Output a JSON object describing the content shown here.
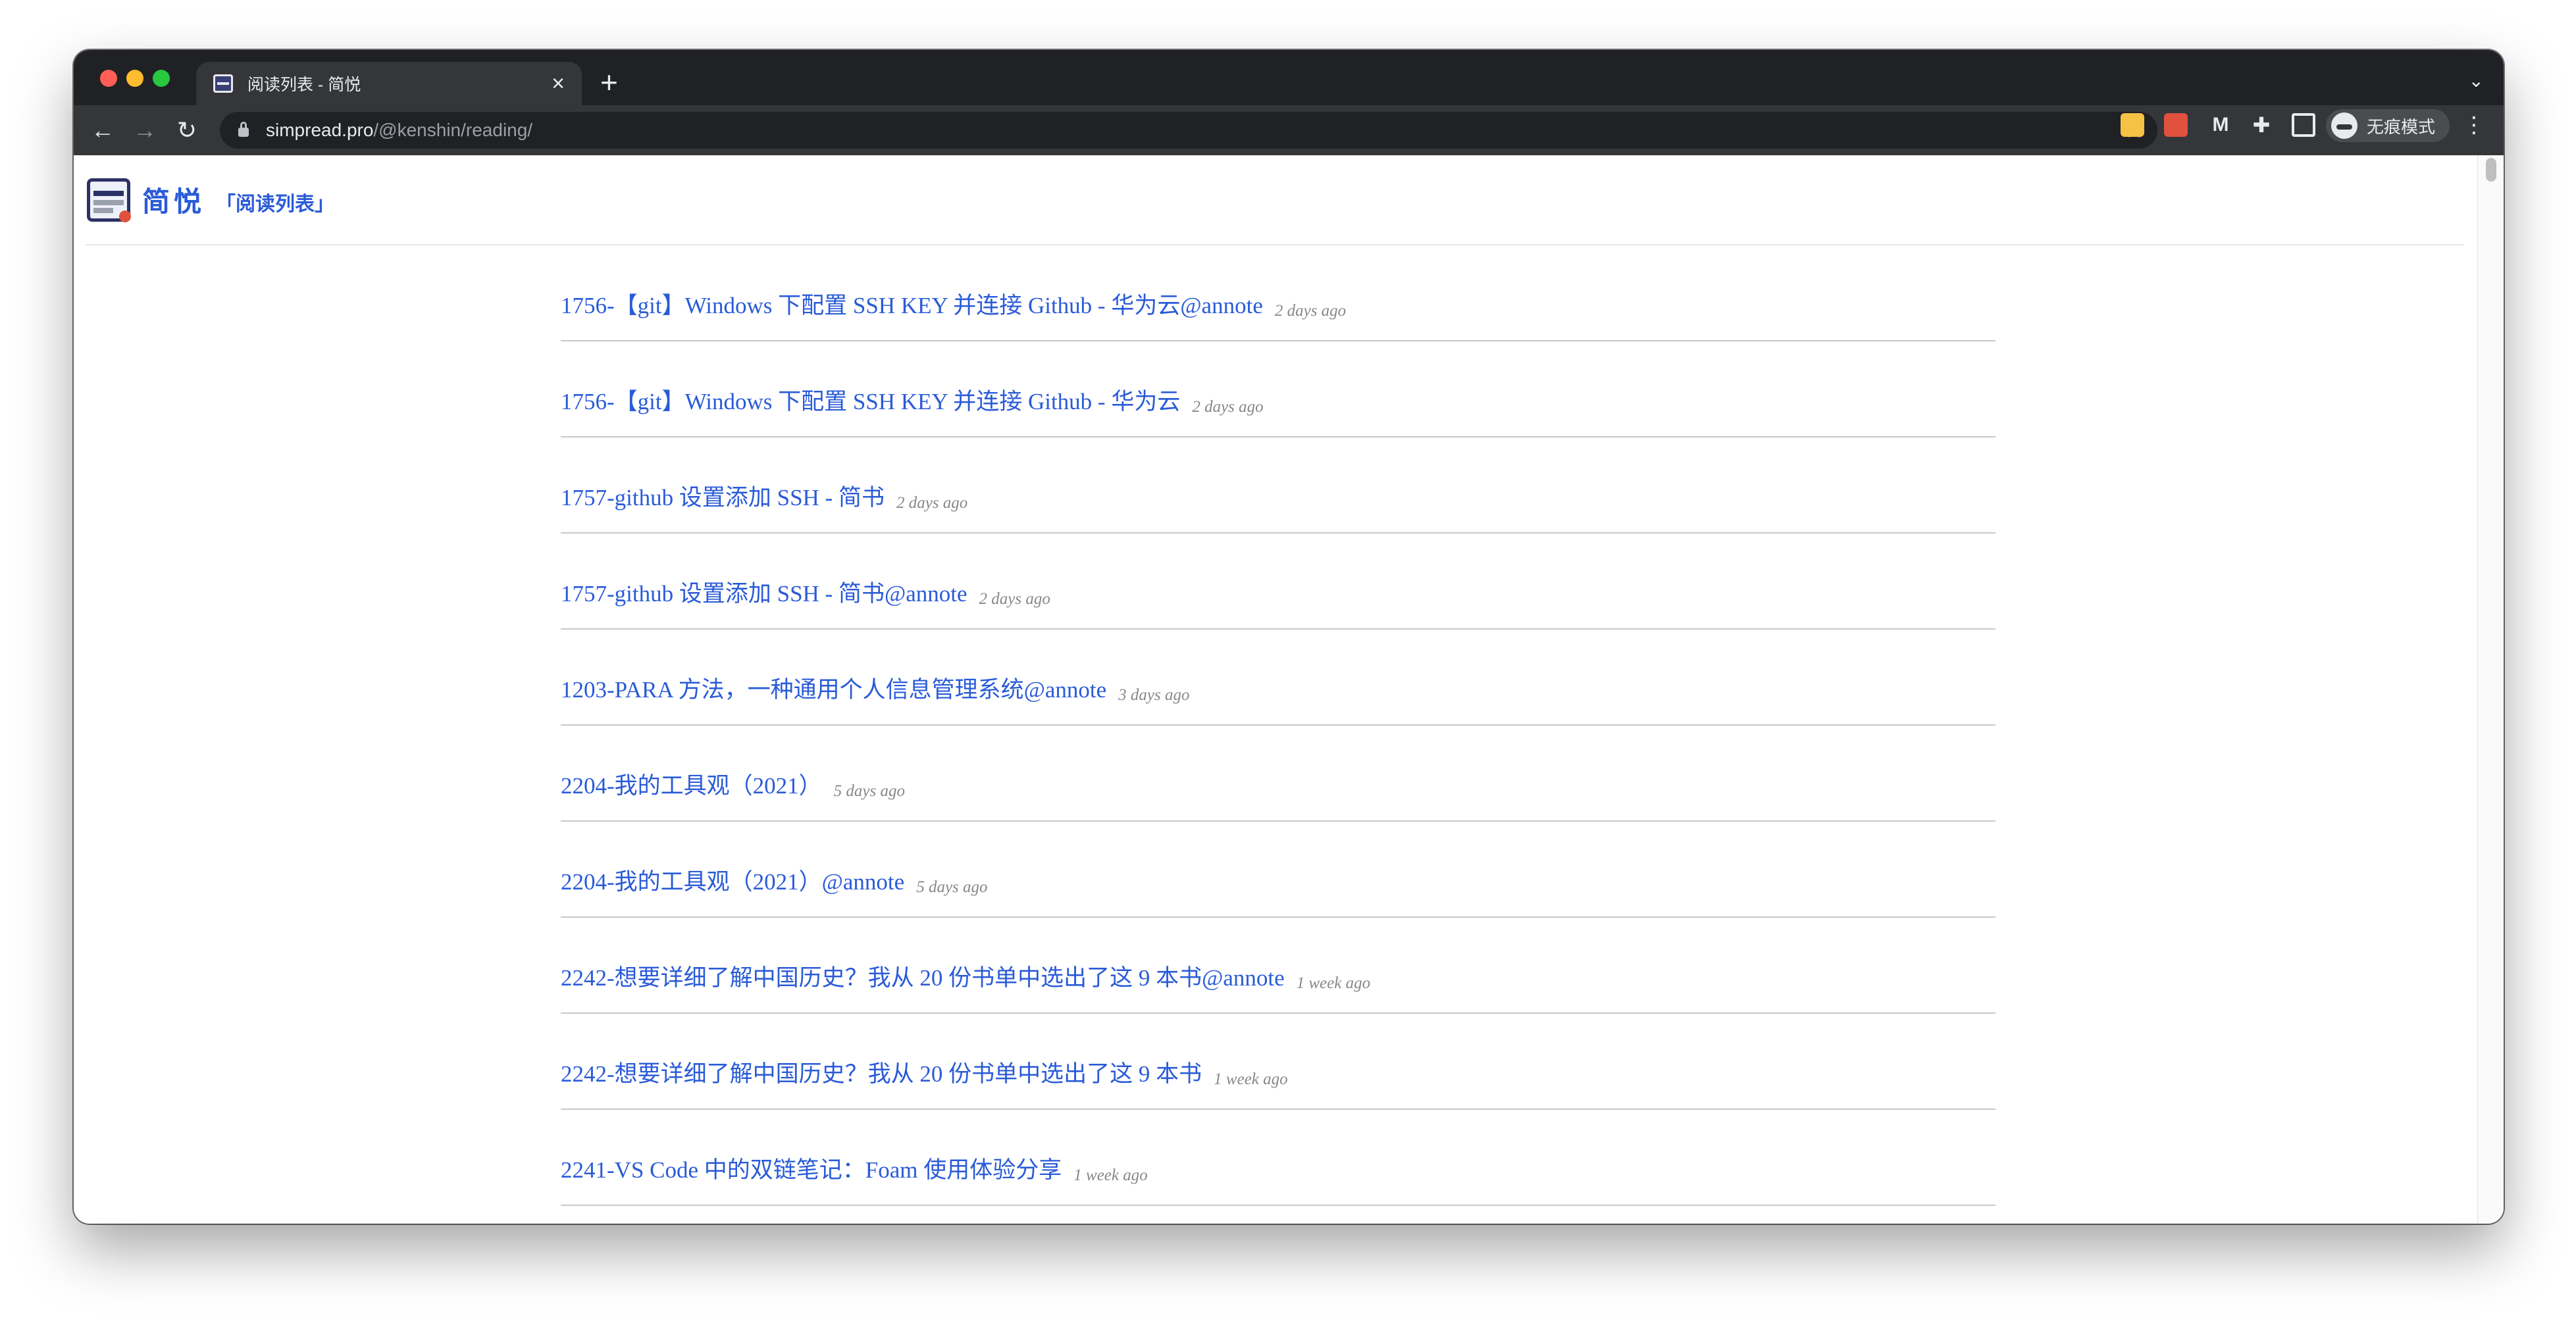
{
  "browser": {
    "tab_title": "阅读列表 - 简悦",
    "tab_close": "×",
    "new_tab": "+",
    "url_host": "simpread.pro",
    "url_path": "/@kenshin/reading/",
    "incognito_label": "无痕模式",
    "icons": [
      "back-icon",
      "forward-icon",
      "reload-icon",
      "lock-icon",
      "star-icon",
      "puzzle-icon",
      "sidepanel-icon",
      "incognito-icon",
      "kebab-menu-icon"
    ]
  },
  "header": {
    "brand": "简悦",
    "crumb": "「阅读列表」"
  },
  "reading_list": [
    {
      "title": "1756-【git】Windows 下配置 SSH KEY 并连接 Github - 华为云@annote",
      "time": "2 days ago"
    },
    {
      "title": "1756-【git】Windows 下配置 SSH KEY 并连接 Github - 华为云",
      "time": "2 days ago"
    },
    {
      "title": "1757-github 设置添加 SSH - 简书",
      "time": "2 days ago"
    },
    {
      "title": "1757-github 设置添加 SSH - 简书@annote",
      "time": "2 days ago"
    },
    {
      "title": "1203-PARA 方法，一种通用个人信息管理系统@annote",
      "time": "3 days ago"
    },
    {
      "title": "2204-我的工具观（2021）",
      "time": "5 days ago"
    },
    {
      "title": "2204-我的工具观（2021）@annote",
      "time": "5 days ago"
    },
    {
      "title": "2242-想要详细了解中国历史？我从 20 份书单中选出了这 9 本书@annote",
      "time": "1 week ago"
    },
    {
      "title": "2242-想要详细了解中国历史？我从 20 份书单中选出了这 9 本书",
      "time": "1 week ago"
    },
    {
      "title": "2241-VS Code 中的双链笔记：Foam 使用体验分享",
      "time": "1 week ago"
    }
  ]
}
